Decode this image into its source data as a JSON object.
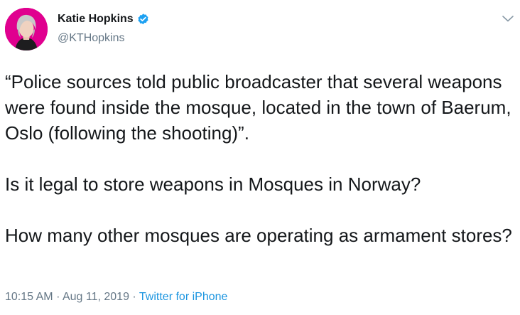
{
  "user": {
    "display_name": "Katie Hopkins",
    "handle": "@KTHopkins",
    "verified": true
  },
  "tweet": {
    "paragraphs": [
      "“Police sources told public broadcaster that several weapons were found inside the mosque, located in the town of Baerum, Oslo (following the shooting)”.",
      "Is it legal to store weapons in Mosques in Norway?",
      "How many other mosques are operating as armament stores?"
    ],
    "time": "10:15 AM",
    "separator": "·",
    "date": "Aug 11, 2019",
    "source": "Twitter for iPhone"
  },
  "icons": {
    "verified": "verified-badge-icon",
    "menu": "chevron-down-icon"
  },
  "colors": {
    "text": "#14171a",
    "secondary": "#657786",
    "link": "#1b95e0",
    "avatar_bg": "#e0008f"
  }
}
